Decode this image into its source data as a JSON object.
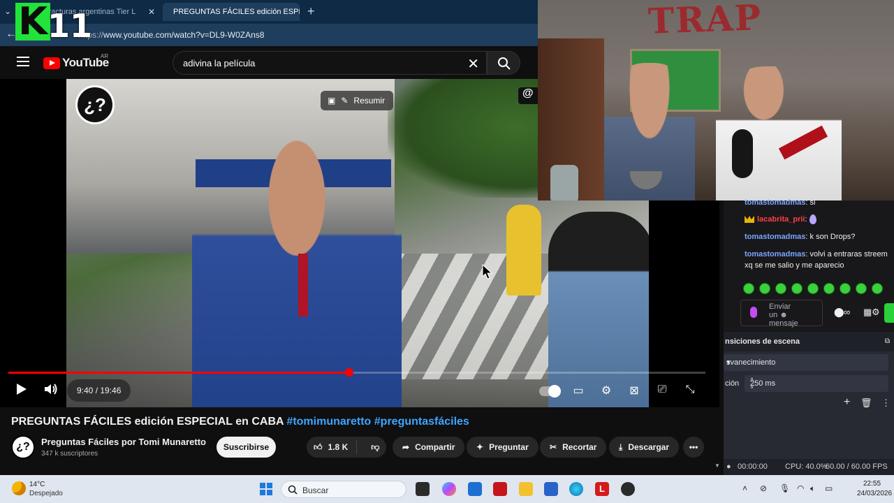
{
  "browser": {
    "tabs": [
      {
        "label": "...te a fracturas argentinas Tier L",
        "close": "✕"
      },
      {
        "label": "PREGUNTAS FÁCILES edición ESPEC",
        "close": "✕"
      }
    ],
    "url_proto": "https://",
    "url_rest": "www.youtube.com/watch?v=DL9-W0ZAns8"
  },
  "overlay": {
    "logo_k": "K",
    "logo_n": "11"
  },
  "youtube": {
    "brand": "YouTube",
    "country": "AR",
    "search_value": "adivina la película",
    "player": {
      "channel_mark": "¿?",
      "resumir_label": "Resumir",
      "at_tag": "@",
      "time": "9:40 / 19:46",
      "progress": 0.489
    },
    "title_main": "PREGUNTAS FÁCILES edición ESPECIAL en CABA ",
    "title_tags": "#tomimunaretto #preguntasfáciles",
    "channel": {
      "avatar": "¿?",
      "name": "Preguntas Fáciles por Tomi Munaretto",
      "subs": "347 k suscriptores",
      "subscribe": "Suscribirse"
    },
    "actions": {
      "likes": "1.8 K",
      "share": "Compartir",
      "ask": "Preguntar",
      "clip": "Recortar",
      "download": "Descargar"
    }
  },
  "webcam": {
    "wall_text": "TRAP"
  },
  "chat": {
    "messages": [
      {
        "user": "tomastomadmas",
        "text": ": si"
      },
      {
        "user": "lacabrita_prii",
        "text": ":"
      },
      {
        "user": "tomastomadmas",
        "text": ": k son Drops?"
      },
      {
        "user": "tomastomadmas",
        "text": ": volvi a entraras streem xq se me salio y me aparecio"
      }
    ],
    "input_placeholder_1": "Enviar",
    "input_placeholder_2": "un",
    "input_placeholder_3": "mensaje",
    "points_label": "∞"
  },
  "obs": {
    "panel_title": "nsiciones de escena",
    "transition": "svanecimiento",
    "duration_label": "ción",
    "duration": "250 ms",
    "status_time": "00:00:00",
    "status_cpu": "CPU: 40.0%",
    "status_fps": "60.00 / 60.00 FPS"
  },
  "taskbar": {
    "temp": "14°C",
    "weather": "Despejado",
    "search": "Buscar",
    "time": "22:55",
    "date": "24/03/2026"
  }
}
